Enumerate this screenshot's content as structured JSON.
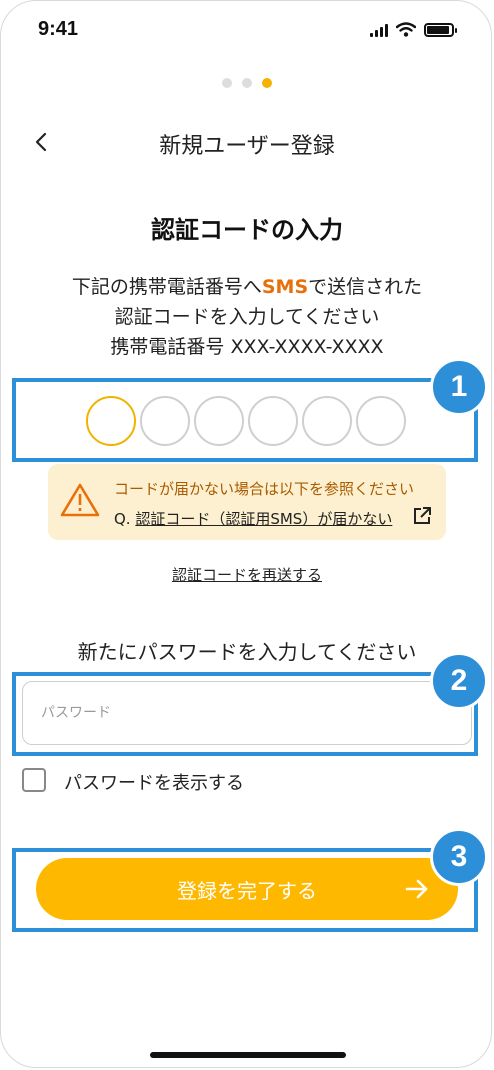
{
  "status_bar": {
    "time": "9:41"
  },
  "steps": {
    "total": 3,
    "current": 3
  },
  "header": {
    "title": "新規ユーザー登録"
  },
  "page": {
    "title": "認証コードの入力",
    "desc_line1_pre": "下記の携帯電話番号へ",
    "desc_line1_sms": "SMS",
    "desc_line1_post": "で送信された",
    "desc_line2": "認証コードを入力してください",
    "desc_line3": "携帯電話番号 XXX-XXXX-XXXX"
  },
  "code": {
    "digits": 6
  },
  "notice": {
    "line1": "コードが届かない場合は以下を参照ください",
    "line2_prefix": "Q. ",
    "line2_link": "認証コード（認証用SMS）が届かない"
  },
  "resend_link": "認証コードを再送する",
  "password": {
    "heading": "新たにパスワードを入力してください",
    "placeholder": "パスワード",
    "show_label": "パスワードを表示する"
  },
  "submit": {
    "label": "登録を完了する"
  },
  "badges": [
    "1",
    "2",
    "3"
  ],
  "colors": {
    "accent": "#ffb800",
    "highlight": "#2d8fd8",
    "sms": "#e8700b",
    "notice_bg": "#fdf0d0"
  }
}
